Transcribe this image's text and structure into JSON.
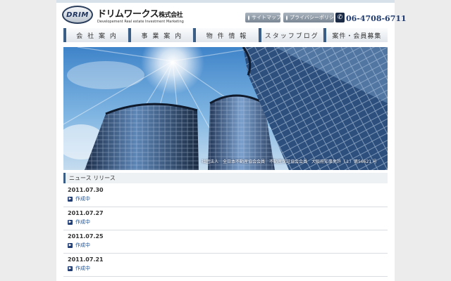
{
  "header": {
    "logo_mark": "DRIM",
    "logo_name": "ドリムワークス",
    "logo_suffix": "株式会社",
    "tagline": "Developement Real estate Investment Marketing",
    "buttons": [
      {
        "label": "サイトマップ"
      },
      {
        "label": "プライバシーポリシー"
      }
    ],
    "phone": "06-4708-6711"
  },
  "nav": [
    {
      "label": "会 社 案 内"
    },
    {
      "label": "事 業 案 内"
    },
    {
      "label": "物 件 情 報"
    },
    {
      "label": "スタッフブログ"
    },
    {
      "label": "案件・会員募集"
    }
  ],
  "hero": {
    "caption": "社団法人　全日本不動産協会会員　不動産保証協会会員　大阪府知事免許（１）第56621 号"
  },
  "news": {
    "title": "ニュース リリース",
    "items": [
      {
        "date": "2011.07.30",
        "link": "作成中"
      },
      {
        "date": "2011.07.27",
        "link": "作成中"
      },
      {
        "date": "2011.07.25",
        "link": "作成中"
      },
      {
        "date": "2011.07.21",
        "link": "作成中"
      }
    ]
  },
  "colors": {
    "accent": "#3b5e86",
    "phone": "#203c72",
    "link": "#1f4f8f",
    "background": "#ececec"
  }
}
